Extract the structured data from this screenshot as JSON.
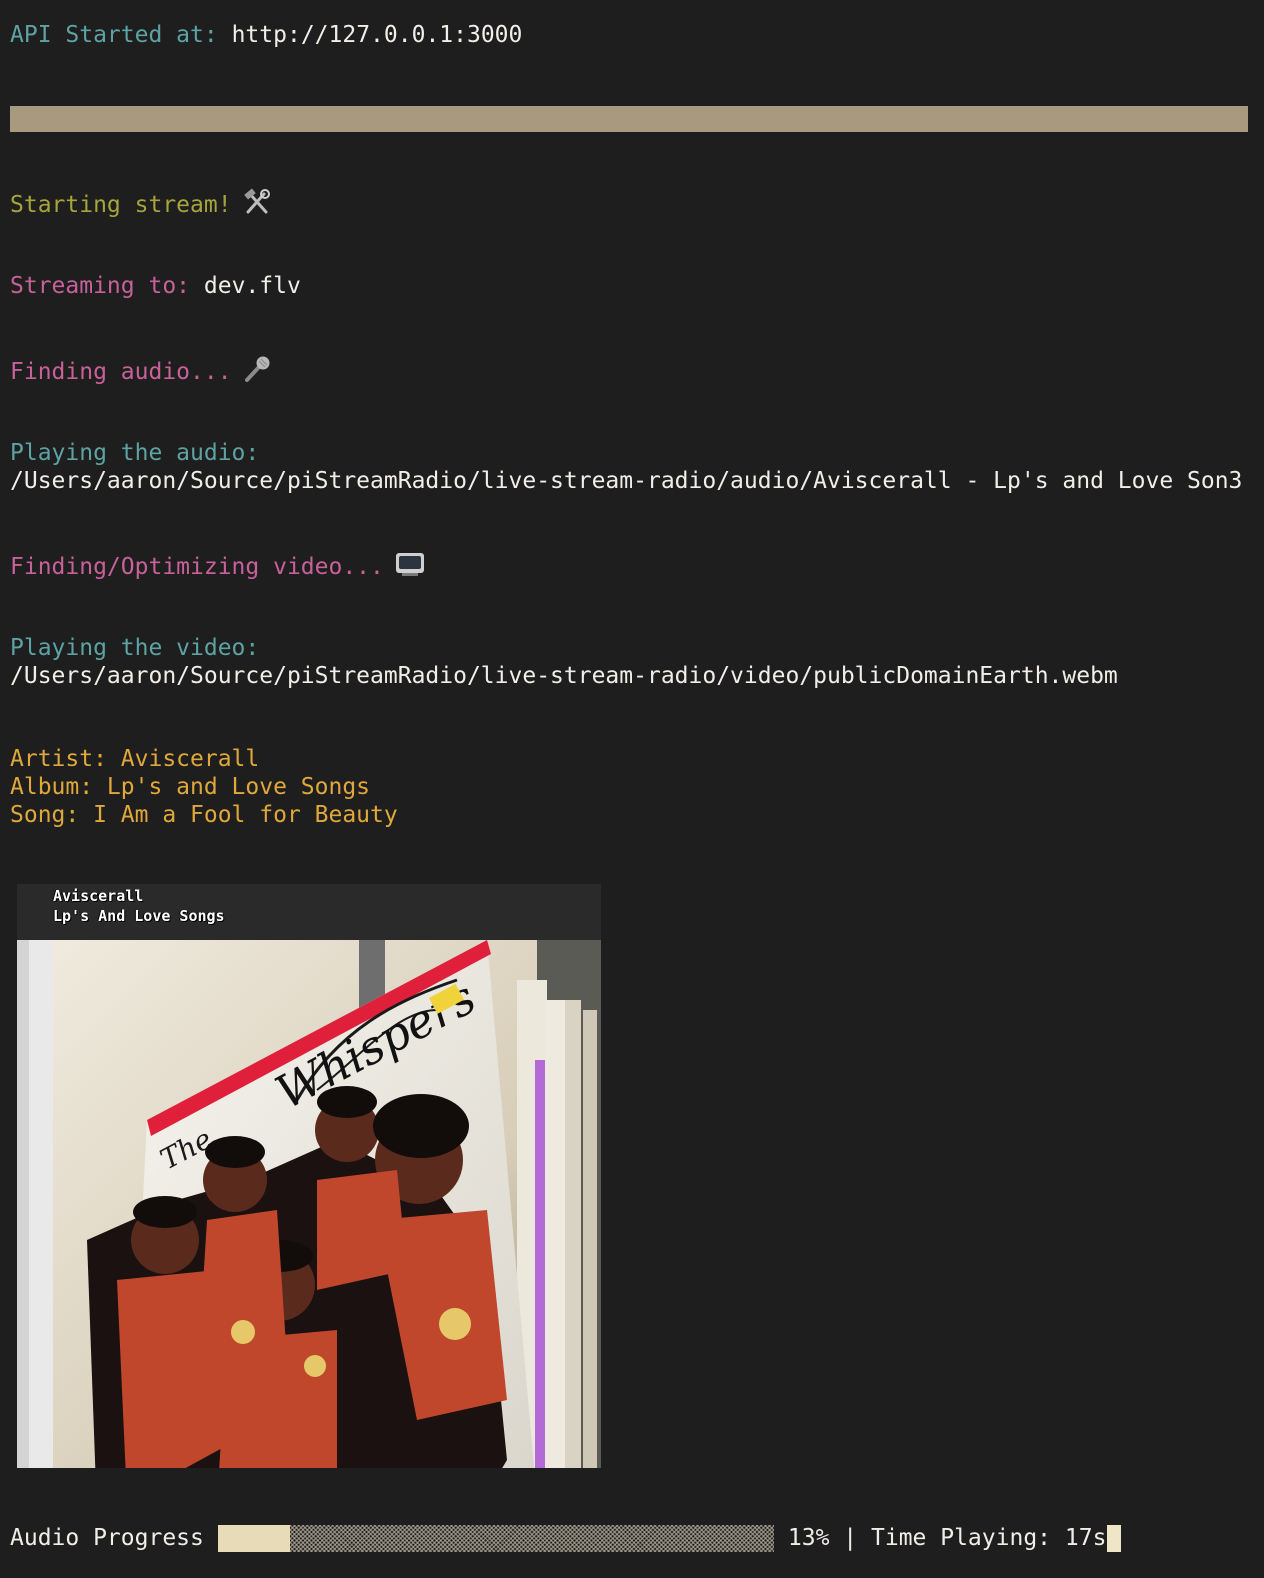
{
  "api": {
    "label": "API Started at:",
    "url": "http://127.0.0.1:3000"
  },
  "stream": {
    "starting": "Starting stream!",
    "starting_icon": "hammer-and-wrench",
    "streaming_label": "Streaming to:",
    "streaming_target": "dev.flv"
  },
  "audio": {
    "finding": "Finding audio...",
    "finding_icon": "microphone",
    "playing_label": "Playing the audio:",
    "path": "/Users/aaron/Source/piStreamRadio/live-stream-radio/audio/Aviscerall - Lp's and Love Son3"
  },
  "video": {
    "finding": "Finding/Optimizing video...",
    "finding_icon": "television",
    "playing_label": "Playing the video:",
    "path": "/Users/aaron/Source/piStreamRadio/live-stream-radio/video/publicDomainEarth.webm"
  },
  "metadata": {
    "artist": "Artist: Aviscerall",
    "album": "Album: Lp's and Love Songs",
    "song": "Song: I Am a Fool for Beauty"
  },
  "cover": {
    "caption_artist": "Aviscerall",
    "caption_album": "Lp's And Love Songs",
    "record_title": "Whispers",
    "record_prefix": "The"
  },
  "progress": {
    "label": "Audio Progress",
    "fraction": 0.13,
    "percent_text": "13%",
    "separator": "|",
    "time_label": "Time Playing:",
    "time_value": "17s"
  },
  "colors": {
    "background": "#1e1e1e",
    "teal": "#5da3a3",
    "olive": "#a6a43c",
    "pink": "#c8609a",
    "gold": "#e0a83a",
    "rule": "#a8997f"
  }
}
